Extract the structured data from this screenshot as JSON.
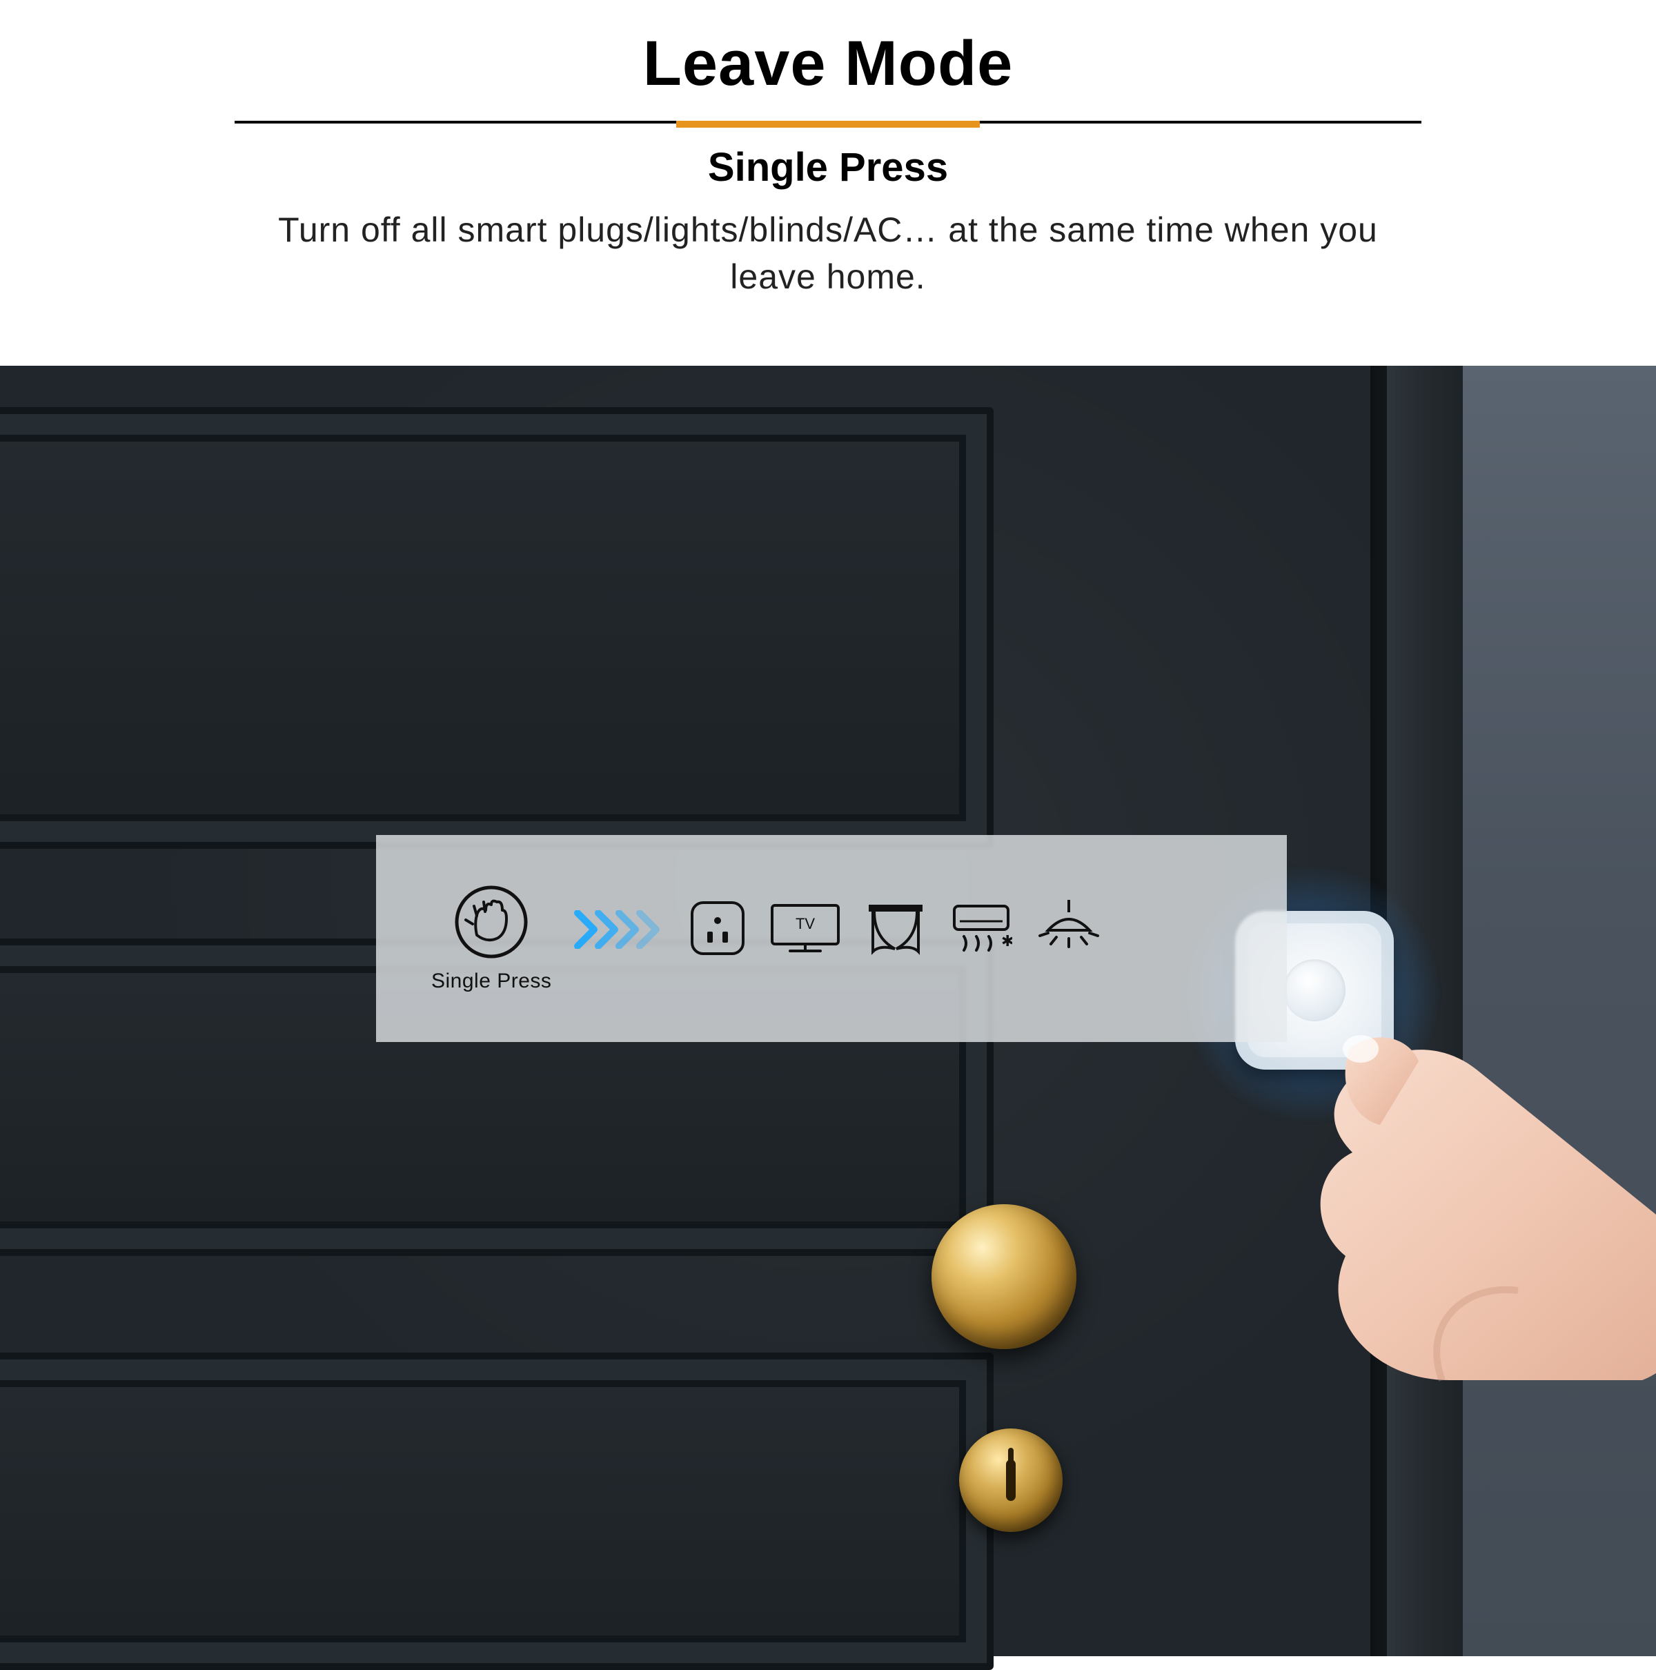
{
  "header": {
    "title": "Leave Mode",
    "subtitle": "Single Press",
    "description": "Turn off all smart plugs/lights/blinds/AC… at the same time when you leave home."
  },
  "strip": {
    "press_label": "Single Press",
    "tv_label": "TV"
  },
  "colors": {
    "accent": "#e7941f",
    "chevron": "#1aa8ff"
  }
}
